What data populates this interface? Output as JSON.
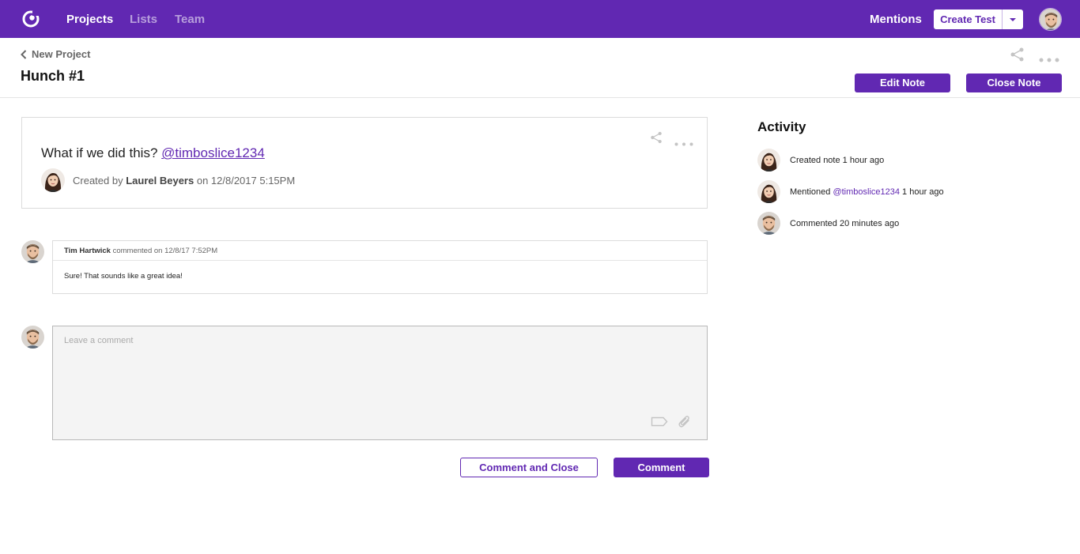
{
  "nav": {
    "items": [
      {
        "label": "Projects",
        "active": true
      },
      {
        "label": "Lists",
        "active": false
      },
      {
        "label": "Team",
        "active": false
      }
    ],
    "mentions_label": "Mentions",
    "create_test_label": "Create Test"
  },
  "header": {
    "back_label": "New Project",
    "title": "Hunch #1",
    "edit_note_label": "Edit Note",
    "close_note_label": "Close Note"
  },
  "note": {
    "text": "What if we did this?",
    "mention": "@timboslice1234",
    "created_prefix": "Created by",
    "author": "Laurel Beyers",
    "created_on": "on 12/8/2017 5:15PM"
  },
  "comments": [
    {
      "author": "Tim Hartwick",
      "meta": "commented on 12/8/17 7:52PM",
      "body": "Sure! That sounds like a great idea!"
    }
  ],
  "new_comment": {
    "placeholder": "Leave a comment",
    "comment_and_close_label": "Comment and Close",
    "comment_label": "Comment"
  },
  "activity": {
    "title": "Activity",
    "items": [
      {
        "avatar": "laurel",
        "text": "Created note 1 hour ago"
      },
      {
        "avatar": "laurel",
        "prefix": "Mentioned",
        "mention": "@timboslice1234",
        "suffix": "1 hour ago"
      },
      {
        "avatar": "tim",
        "text": "Commented 20 minutes ago"
      }
    ]
  },
  "colors": {
    "brand": "#6128b2",
    "border": "#dcdcdc",
    "muted_text": "#666666"
  },
  "icons": [
    "logo-icon",
    "chevron-down-icon",
    "chevron-left-icon",
    "share-icon",
    "more-icon",
    "tag-icon",
    "paperclip-icon"
  ]
}
